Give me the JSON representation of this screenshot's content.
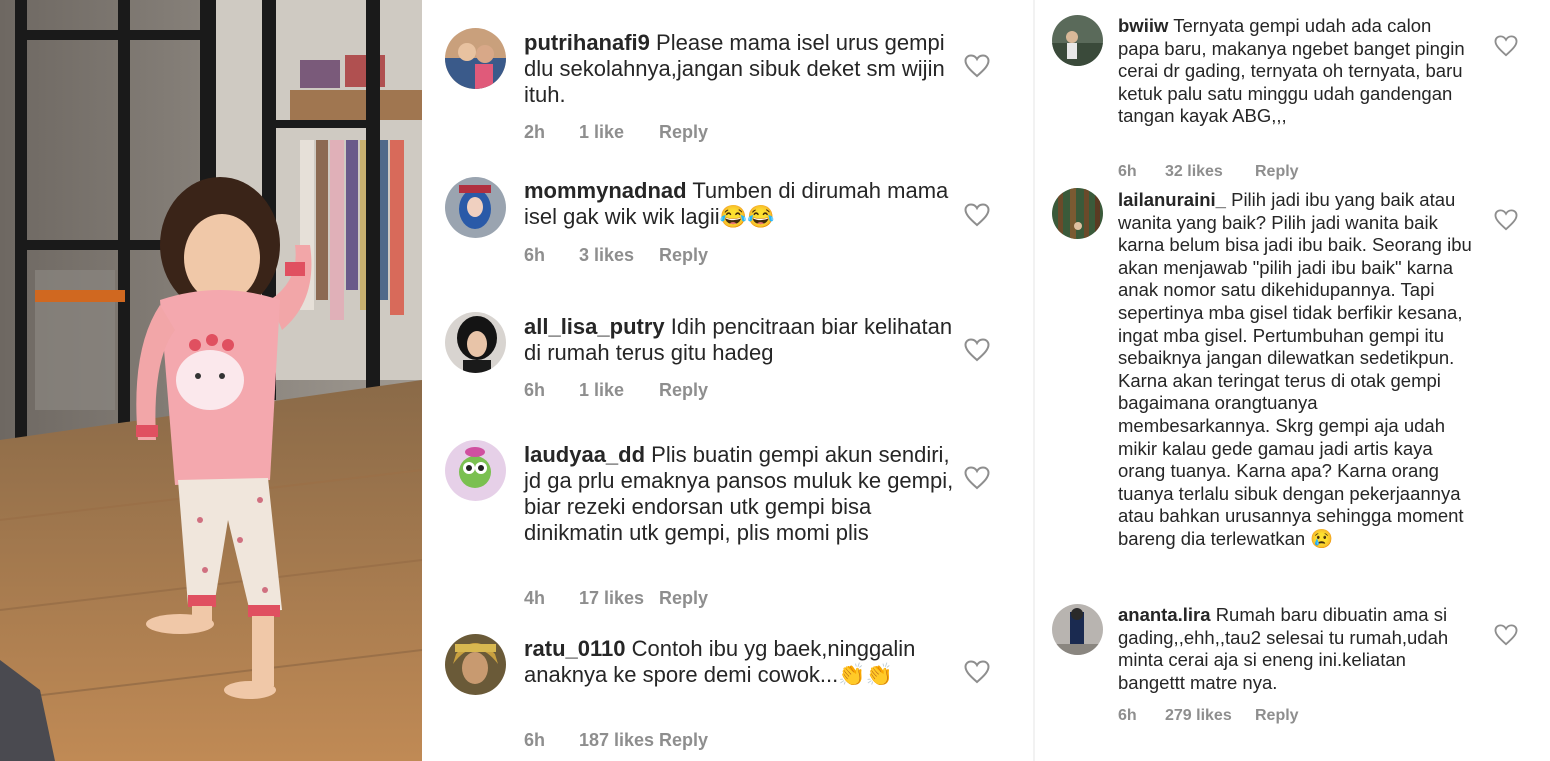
{
  "colors": {
    "text": "#262626",
    "meta": "#8e8e8e",
    "heart_stroke": "#8e8e8e",
    "background": "#ffffff"
  },
  "photo": {
    "icon": "photo-of-child-in-pink-pajamas"
  },
  "comments_middle": [
    {
      "username": "putrihanafi9",
      "text": "Please mama isel urus gempi dlu sekolahnya,jangan sibuk deket sm wijin ituh.",
      "time": "2h",
      "likes": "1 like",
      "reply": "Reply",
      "avatar_icon": "user-avatar"
    },
    {
      "username": "mommynadnad",
      "text": "Tumben di dirumah mama isel gak wik wik lagii😂😂",
      "time": "6h",
      "likes": "3 likes",
      "reply": "Reply",
      "avatar_icon": "user-avatar"
    },
    {
      "username": "all_lisa_putry",
      "text": "Idih pencitraan  biar kelihatan  di rumah terus gitu hadeg",
      "time": "6h",
      "likes": "1 like",
      "reply": "Reply",
      "avatar_icon": "user-avatar"
    },
    {
      "username": "laudyaa_dd",
      "text": "Plis buatin gempi akun sendiri, jd ga prlu emaknya pansos muluk ke gempi, biar rezeki endorsan utk gempi bisa dinikmatin utk gempi, plis momi plis",
      "time": "4h",
      "likes": "17 likes",
      "reply": "Reply",
      "avatar_icon": "user-avatar"
    },
    {
      "username": "ratu_0110",
      "text": "Contoh ibu yg baek,ninggalin anaknya ke spore demi cowok...👏👏",
      "time": "6h",
      "likes": "187 likes",
      "reply": "Reply",
      "avatar_icon": "user-avatar"
    }
  ],
  "comments_right": [
    {
      "username": "bwiiw",
      "text": "Ternyata gempi udah ada calon papa baru, makanya ngebet banget pingin cerai dr gading, ternyata oh ternyata, baru ketuk palu satu minggu udah gandengan tangan kayak ABG,,,",
      "time": "6h",
      "likes": "32 likes",
      "reply": "Reply",
      "avatar_icon": "user-avatar"
    },
    {
      "username": "lailanuraini_",
      "text": "Pilih jadi ibu yang baik atau wanita yang baik? Pilih jadi wanita baik karna belum bisa jadi ibu baik. Seorang ibu akan menjawab \"pilih jadi ibu baik\" karna anak nomor satu dikehidupannya. Tapi sepertinya mba gisel tidak berfikir kesana, ingat mba gisel. Pertumbuhan gempi itu sebaiknya jangan dilewatkan sedetikpun. Karna akan teringat terus di otak gempi bagaimana orangtuanya membesarkannya. Skrg gempi aja udah mikir kalau gede gamau jadi artis kaya orang tuanya. Karna apa? Karna orang tuanya terlalu sibuk dengan pekerjaannya atau bahkan urusannya sehingga moment bareng dia terlewatkan 😢",
      "time": "",
      "likes": "",
      "reply": "",
      "avatar_icon": "user-avatar"
    },
    {
      "username": "ananta.lira",
      "text": "Rumah baru dibuatin ama si gading,,ehh,,tau2 selesai tu rumah,udah minta cerai aja si eneng ini.keliatan bangettt matre nya.",
      "time": "6h",
      "likes": "279 likes",
      "reply": "Reply",
      "avatar_icon": "user-avatar"
    }
  ]
}
